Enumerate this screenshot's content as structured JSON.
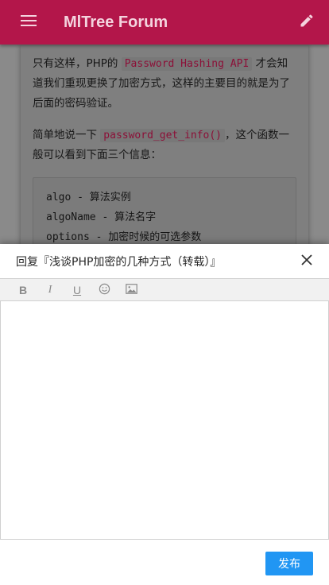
{
  "appbar": {
    "title": "MlTree Forum",
    "menu_icon": "menu-icon",
    "edit_icon": "pencil-icon",
    "color": "#b3164a"
  },
  "post": {
    "para1": {
      "before": "只有这样，PHP的 ",
      "code": "Password Hashing API",
      "after": " 才会知道我们重现更换了加密方式，这样的主要目的就是为了后面的密码验证。"
    },
    "para2": {
      "before": "简单地说一下 ",
      "code": "password_get_info()",
      "after": "，这个函数一般可以看到下面三个信息："
    },
    "code_lines": [
      "algo - 算法实例",
      "algoName - 算法名字",
      "options - 加密时候的可选参数"
    ]
  },
  "reply": {
    "title": "回复『浅谈PHP加密的几种方式（转载）』",
    "close_icon": "close-icon",
    "toolbar": {
      "bold": "B",
      "italic": "I",
      "underline": "U",
      "emoji_icon": "smiley-icon",
      "image_icon": "image-icon"
    },
    "editor_value": "",
    "publish_label": "发布",
    "publish_color": "#2196f3"
  }
}
